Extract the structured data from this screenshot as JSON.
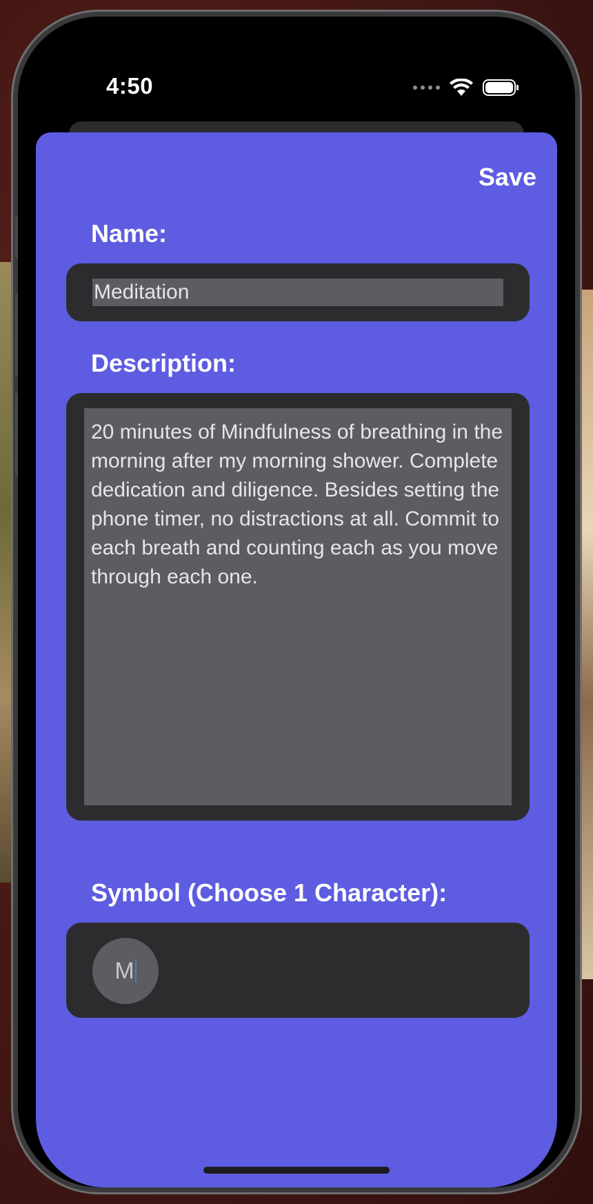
{
  "status_bar": {
    "time": "4:50",
    "icons": [
      "signal-dots-icon",
      "wifi-icon",
      "battery-icon"
    ]
  },
  "form": {
    "save_label": "Save",
    "name_label": "Name:",
    "name_value": "Meditation",
    "description_label": "Description:",
    "description_value": "20 minutes of Mindfulness of breathing in the morning after my morning shower. Complete dedication and diligence. Besides setting the phone timer, no distractions at all. Commit to each breath and counting each as you move through each one.",
    "symbol_label": "Symbol (Choose 1 Character):",
    "symbol_value": "M"
  },
  "colors": {
    "sheet_background": "#5e5ce0",
    "field_background": "#2c2c2e",
    "input_background": "#5c5c61",
    "text_white": "#ffffff"
  }
}
